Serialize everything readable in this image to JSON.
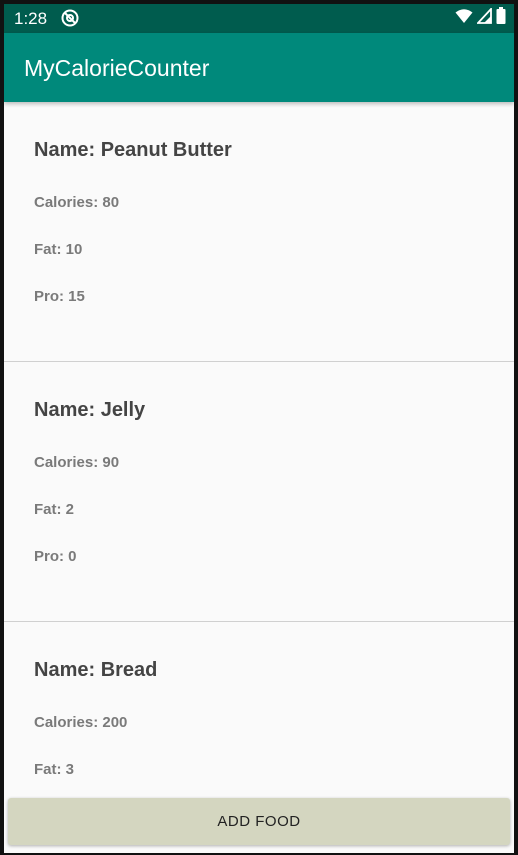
{
  "status_bar": {
    "time": "1:28",
    "icons": [
      "notification-icon",
      "wifi-icon",
      "signal-icon",
      "battery-icon"
    ]
  },
  "app_bar": {
    "title": "MyCalorieCounter"
  },
  "food_list": {
    "items": [
      {
        "name": "Name: Peanut Butter",
        "calories": "Calories: 80",
        "fat": "Fat: 10",
        "pro": "Pro: 15"
      },
      {
        "name": "Name: Jelly",
        "calories": "Calories: 90",
        "fat": "Fat: 2",
        "pro": "Pro: 0"
      },
      {
        "name": "Name: Bread",
        "calories": "Calories: 200",
        "fat": "Fat: 3"
      }
    ]
  },
  "add_food_button": {
    "label": "ADD FOOD"
  },
  "colors": {
    "status_bar": "#005c4e",
    "app_bar": "#00897b",
    "button": "#d4d6c0",
    "background": "#fafafa"
  }
}
